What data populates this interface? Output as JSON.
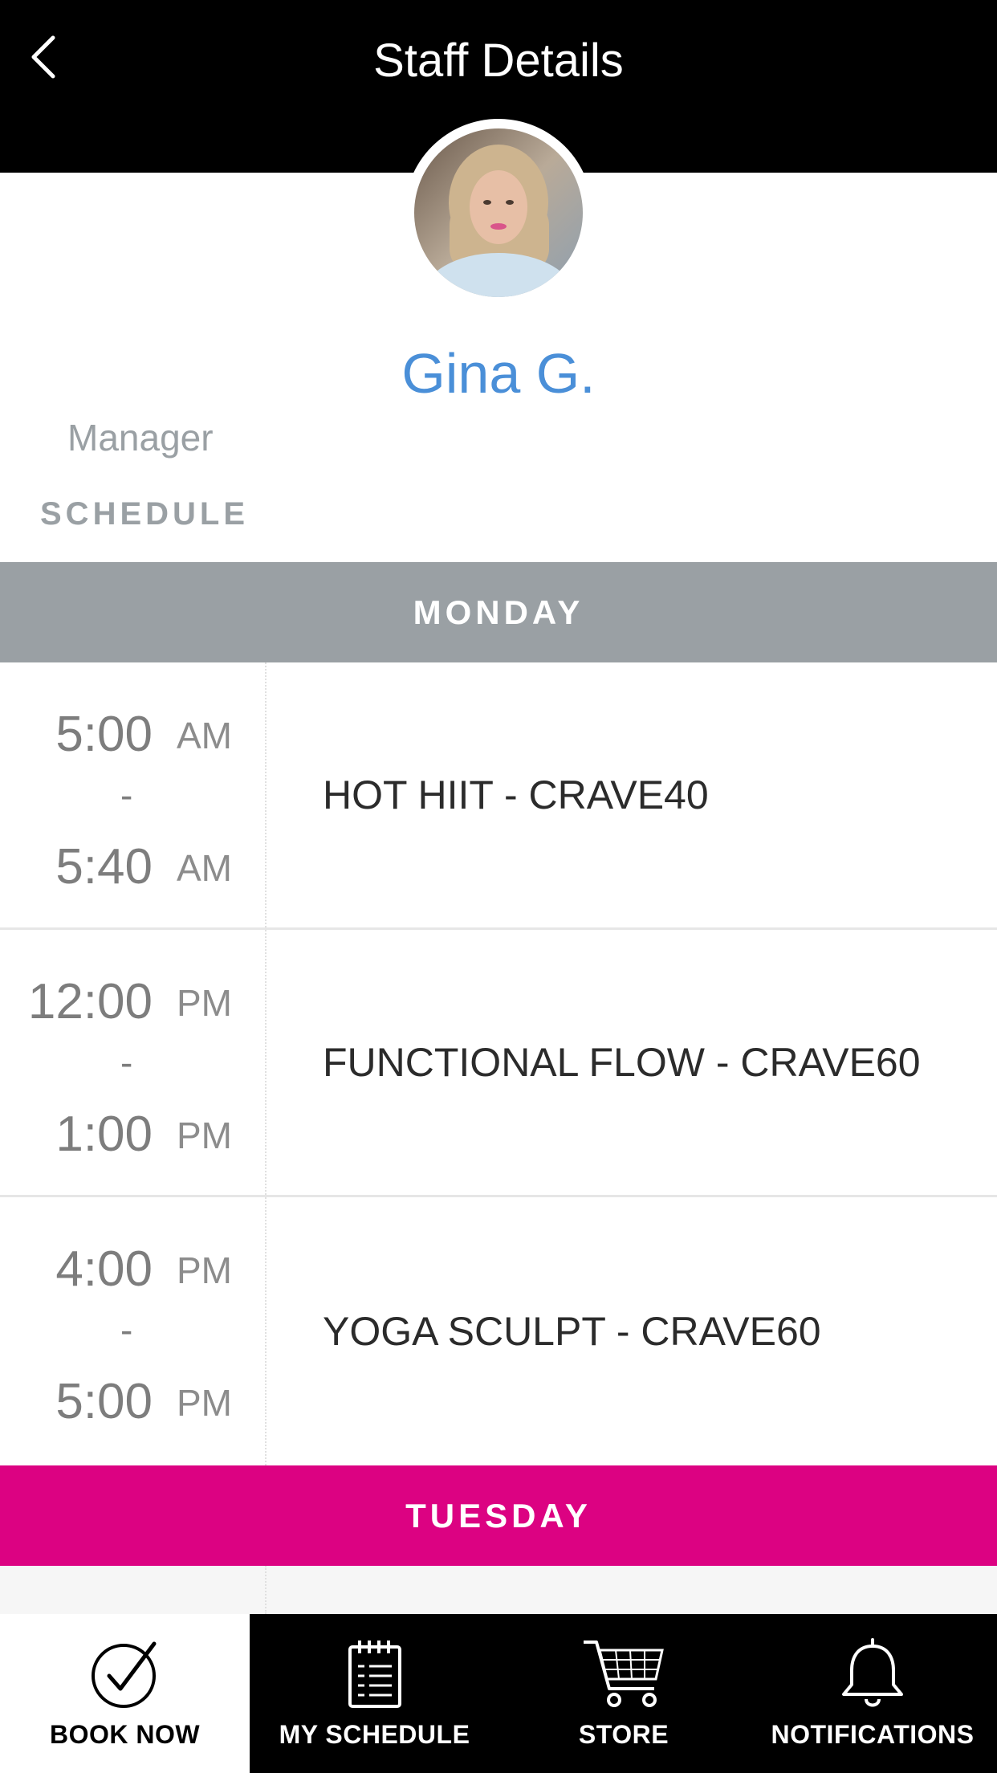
{
  "header": {
    "title": "Staff Details"
  },
  "staff": {
    "name": "Gina G.",
    "role": "Manager",
    "schedule_label": "SCHEDULE"
  },
  "schedule": {
    "days": [
      {
        "day": "MONDAY",
        "classes": [
          {
            "start": "5:00",
            "start_ampm": "AM",
            "separator": "-",
            "end": "5:40",
            "end_ampm": "AM",
            "name": "HOT HIIT - CRAVE40"
          },
          {
            "start": "12:00",
            "start_ampm": "PM",
            "separator": "-",
            "end": "1:00",
            "end_ampm": "PM",
            "name": "FUNCTIONAL FLOW - CRAVE60"
          },
          {
            "start": "4:00",
            "start_ampm": "PM",
            "separator": "-",
            "end": "5:00",
            "end_ampm": "PM",
            "name": "YOGA SCULPT - CRAVE60"
          }
        ]
      },
      {
        "day": "TUESDAY",
        "classes": []
      }
    ]
  },
  "nav": {
    "items": [
      {
        "label": "BOOK NOW",
        "icon": "check-circle-icon",
        "active": true
      },
      {
        "label": "MY SCHEDULE",
        "icon": "calendar-notepad-icon",
        "active": false
      },
      {
        "label": "STORE",
        "icon": "shopping-cart-icon",
        "active": false
      },
      {
        "label": "NOTIFICATIONS",
        "icon": "bell-icon",
        "active": false
      }
    ]
  },
  "colors": {
    "header_bg": "#000000",
    "name_blue": "#4a8fd8",
    "monday_header": "#9aa0a4",
    "tuesday_header": "#dc0282",
    "nav_bg": "#000000"
  }
}
